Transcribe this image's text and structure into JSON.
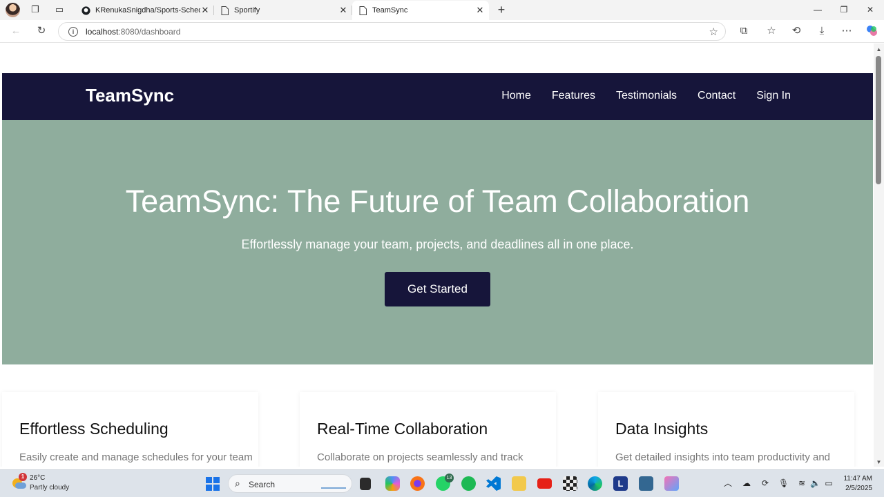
{
  "browser": {
    "tabs": [
      {
        "label": "KRenukaSnigdha/Sports-Schedule",
        "icon": "github-icon",
        "active": false
      },
      {
        "label": "Sportify",
        "icon": "page-icon",
        "active": false
      },
      {
        "label": "TeamSync",
        "icon": "page-icon",
        "active": true
      }
    ],
    "url_host": "localhost",
    "url_path": ":8080/dashboard"
  },
  "page": {
    "brand": "TeamSync",
    "nav": [
      "Home",
      "Features",
      "Testimonials",
      "Contact",
      "Sign In"
    ],
    "hero": {
      "title": "TeamSync: The Future of Team Collaboration",
      "subtitle": "Effortlessly manage your team, projects, and deadlines all in one place.",
      "cta": "Get Started"
    },
    "features": [
      {
        "title": "Effortless Scheduling",
        "text": "Easily create and manage schedules for your team"
      },
      {
        "title": "Real-Time Collaboration",
        "text": "Collaborate on projects seamlessly and track"
      },
      {
        "title": "Data Insights",
        "text": "Get detailed insights into team productivity and"
      }
    ],
    "colors": {
      "navbar": "#16153a",
      "hero": "#8fad9d",
      "button": "#16153a"
    }
  },
  "taskbar": {
    "weather_temp": "26°C",
    "weather_cond": "Partly cloudy",
    "weather_badge": "1",
    "search_label": "Search",
    "whatsapp_badge": "13",
    "time": "11:47 AM",
    "date": "2/5/2025"
  }
}
